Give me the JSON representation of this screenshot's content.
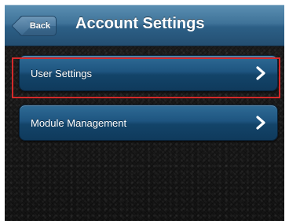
{
  "nav_bar": {
    "back_label": "Back",
    "title": "Account Settings"
  },
  "menu": {
    "items": [
      {
        "label": "User Settings",
        "icon": "chevron-right-icon",
        "highlighted": true
      },
      {
        "label": "Module Management",
        "icon": "chevron-right-icon",
        "highlighted": false
      }
    ]
  },
  "colors": {
    "nav_bar": "#3f7399",
    "menu_item": "#1e5580",
    "background": "#141414",
    "highlight": "#d42a2a"
  }
}
